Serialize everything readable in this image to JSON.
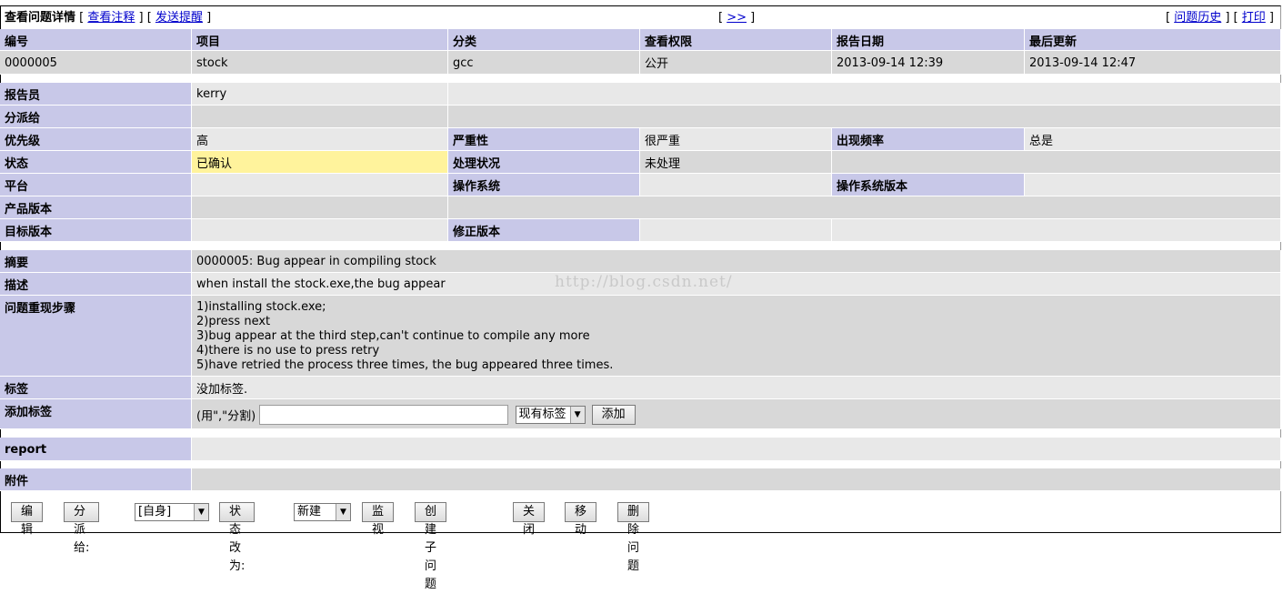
{
  "header": {
    "title": "查看问题详情",
    "link_notes": "查看注释",
    "link_remind": "发送提醒",
    "link_next": ">>",
    "link_history": "问题历史",
    "link_print": "打印"
  },
  "summary_table": {
    "headers": [
      "编号",
      "项目",
      "分类",
      "查看权限",
      "报告日期",
      "最后更新"
    ],
    "values": [
      "0000005",
      "stock",
      "gcc",
      "公开",
      "2013-09-14 12:39",
      "2013-09-14 12:47"
    ]
  },
  "details": {
    "reporter_label": "报告员",
    "reporter": "kerry",
    "assigned_label": "分派给",
    "assigned": "",
    "priority_label": "优先级",
    "priority": "高",
    "severity_label": "严重性",
    "severity": "很严重",
    "reproducibility_label": "出现频率",
    "reproducibility": "总是",
    "status_label": "状态",
    "status": "已确认",
    "resolution_label": "处理状况",
    "resolution": "未处理",
    "platform_label": "平台",
    "os_label": "操作系统",
    "os_version_label": "操作系统版本",
    "product_version_label": "产品版本",
    "target_version_label": "目标版本",
    "fixed_version_label": "修正版本",
    "status_color": "#fff39c"
  },
  "description": {
    "summary_label": "摘要",
    "summary": "0000005: Bug appear in compiling stock",
    "description_label": "描述",
    "description": "when install the stock.exe,the bug appear",
    "steps_label": "问题重现步骤",
    "steps": [
      "1)installing stock.exe;",
      "2)press next",
      "3)bug appear at the third step,can't continue to compile any more",
      "4)there is no use to press retry",
      "5)have retried the process three times, the bug appeared three times."
    ],
    "tags_label": "标签",
    "tags": "没加标签.",
    "add_tag_label": "添加标签",
    "add_tag_hint": "(用\",\"分割)",
    "add_tag_input_value": "",
    "existing_tags_select": "现有标签",
    "add_button": "添加"
  },
  "report_label": "report",
  "attachments_label": "附件",
  "watermark": "http://blog.csdn.net/",
  "actions": {
    "edit": "编辑",
    "assign_to": "分派给:",
    "assign_select": "[自身]",
    "change_status": "状态改为:",
    "status_select": "新建",
    "monitor": "监视",
    "create_child": "创建子问题",
    "close": "关闭",
    "move": "移动",
    "delete": "删除问题"
  },
  "colors": {
    "header_bg": "#c8c8e8",
    "row_dark": "#d8d8d8",
    "row_light": "#e8e8e8",
    "link": "#0000cc"
  }
}
